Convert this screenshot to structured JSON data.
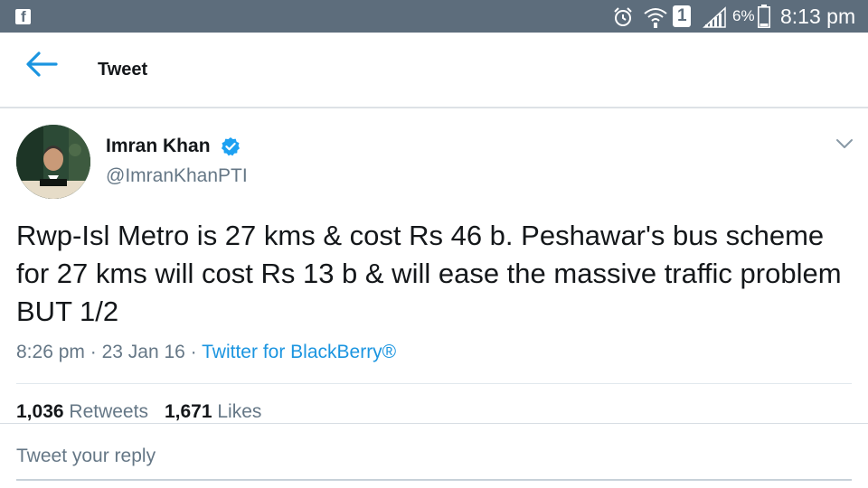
{
  "status_bar": {
    "battery": "6%",
    "sim_slot": "1",
    "time": "8:13 pm",
    "icons": [
      "facebook-icon",
      "alarm-icon",
      "wifi-icon",
      "signal-icon",
      "battery-icon"
    ]
  },
  "header": {
    "title": "Tweet",
    "back_icon": "arrow-left-icon"
  },
  "tweet": {
    "author_name": "Imran Khan",
    "verified": true,
    "handle": "@ImranKhanPTI",
    "text": "Rwp-Isl Metro is 27 kms & cost Rs 46 b. Peshawar's bus scheme for 27 kms will cost Rs 13 b & will ease the massive traffic problem BUT 1/2",
    "time": "8:26 pm",
    "separator": "·",
    "date": "23 Jan 16",
    "source": "Twitter for BlackBerry®",
    "retweets_count": "1,036",
    "retweets_label": "Retweets",
    "likes_count": "1,671",
    "likes_label": "Likes"
  },
  "reply": {
    "placeholder": "Tweet your reply"
  },
  "colors": {
    "status_bar": "#5d6d7c",
    "accent": "#1b95e0",
    "secondary_text": "#657786",
    "primary_text": "#14171a"
  }
}
